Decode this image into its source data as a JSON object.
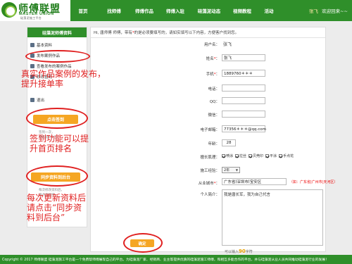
{
  "header": {
    "logo": {
      "cn": "师傅联盟",
      "en": "MASTER UNION",
      "tagline": "硅藻泥施工平台"
    },
    "nav": [
      {
        "label": "首页"
      },
      {
        "label": "找师傅"
      },
      {
        "label": "师傅作品"
      },
      {
        "label": "师傅入驻"
      },
      {
        "label": "硅藻泥动态"
      },
      {
        "label": "视频教程"
      },
      {
        "label": "活动"
      }
    ],
    "user": {
      "name": "张飞",
      "greeting": "欢迎回来~~"
    }
  },
  "sidebar": {
    "title": "硅藻泥师傅资料",
    "items": [
      {
        "label": "基本资料",
        "icon": "doc-icon"
      },
      {
        "label": "发布案例作品",
        "icon": "upload-icon"
      },
      {
        "label": "查看发布的案例作品",
        "icon": "list-icon"
      },
      {
        "label": "修改密码",
        "icon": "lock-icon"
      },
      {
        "label": "退出",
        "icon": "exit-icon"
      }
    ],
    "checkin_label": "点击签到",
    "checkin_tip": [
      "签到一次，",
      "排名提升1位！"
    ],
    "sync_label": "同步资料到后台",
    "sync_tip": [
      "每次修改资料后，",
      "请点击同步。"
    ]
  },
  "form": {
    "hint_prefix": "Hi, 唐师傅 师傅，带有",
    "hint_star": "*",
    "hint_suffix": "的是必须要填写的，请如实填写以下内容，方便客户找到您。",
    "username_label": "用户名：",
    "username_value": "张飞",
    "name_label": "姓名",
    "name_value": "张飞",
    "phone_label": "手机",
    "phone_value": "1889760＊＊＊",
    "tel_label": "电话：",
    "qq_label": "QQ：",
    "wechat_label": "微信：",
    "email_label": "电子邮箱：",
    "email_value": "77356＊＊＊@qq.com",
    "age_label": "年龄：",
    "age_value": "28",
    "skills_label": "擅长肌理",
    "skills": [
      {
        "label": "喷涂",
        "checked": true
      },
      {
        "label": "拉丝",
        "checked": true
      },
      {
        "label": "贝壳印",
        "checked": true
      },
      {
        "label": "平涂",
        "checked": true
      },
      {
        "label": "手点花",
        "checked": true
      }
    ],
    "experience_label": "施工经验",
    "experience_value": "2年",
    "city_label": "从业城市",
    "city_province": "广东省",
    "city_city": "深圳市",
    "city_district": "宝安区",
    "city_example": "（如：广东省|广州市|天河区）",
    "intro_label": "个人简介",
    "intro_value": "我是唐长军，我为自己代言",
    "remaining_prefix": "可以输入",
    "remaining_count": "90",
    "remaining_suffix": "字符",
    "submit_label": "确定"
  },
  "footer": {
    "text": "Copyright © 2017 师傅联盟 硅藻泥施工平台是一个免费帮师傅展现自己的平台。为硅藻泥厂家、经销商、业主等提供优质的硅藻泥施工师傅，和相互多能合作的平台，并与硅藻泥从业人员共同推动硅藻泥行业的发展！"
  },
  "annotations": {
    "publish": [
      "真实作品案例的发布，",
      "提升接单率"
    ],
    "checkin": [
      "签到功能可以提",
      "升首页排名"
    ],
    "sync": [
      "每次更新资料后",
      "请点击“同步资",
      "料到后台”"
    ]
  },
  "colors": {
    "brand_green": "#2f8f2a",
    "accent_orange": "#f5a623",
    "annotation_red": "#e02020"
  }
}
